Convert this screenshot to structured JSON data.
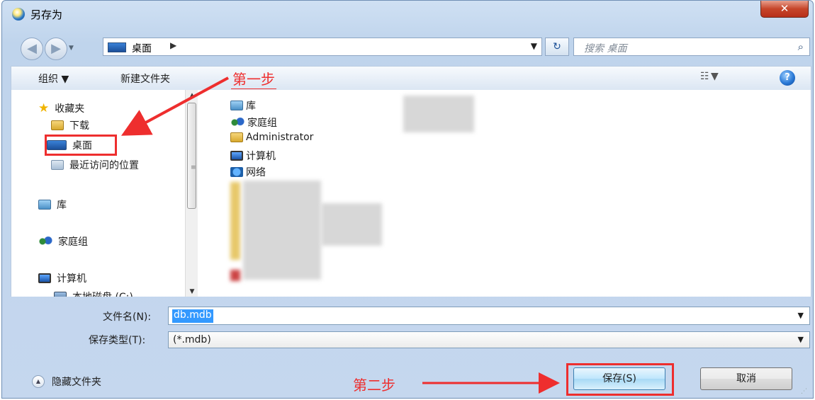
{
  "window": {
    "title": "另存为",
    "close_glyph": "✕"
  },
  "nav": {
    "back_glyph": "◀",
    "forward_glyph": "▶",
    "address": "桌面",
    "address_arrow": "▶",
    "address_drop": "▼",
    "refresh_glyph": "↻",
    "search_placeholder": "搜索 桌面",
    "search_glyph": "⌕"
  },
  "toolbar": {
    "organize": "组织 ▼",
    "new_folder": "新建文件夹",
    "view": "☷ ▼",
    "help": "?"
  },
  "sidebar": {
    "favorites": "收藏夹",
    "downloads": "下载",
    "desktop": "桌面",
    "recent": "最近访问的位置",
    "libraries": "库",
    "homegroup": "家庭组",
    "computer": "计算机",
    "local_disk": "本地磁盘 (C:)"
  },
  "files": {
    "library": "库",
    "homegroup": "家庭组",
    "admin": "Administrator",
    "computer": "计算机",
    "network": "网络"
  },
  "annotations": {
    "step1": "第一步",
    "step2": "第二步"
  },
  "form": {
    "filename_label": "文件名(N):",
    "filename_value": "db.mdb",
    "filetype_label": "保存类型(T):",
    "filetype_value": "(*.mdb)",
    "drop_glyph": "▼"
  },
  "footer": {
    "hide_folders": "隐藏文件夹",
    "save": "保存(S)",
    "cancel": "取消"
  },
  "colors": {
    "annotation_red": "#ee2e2e",
    "selection_blue": "#3399ff"
  }
}
